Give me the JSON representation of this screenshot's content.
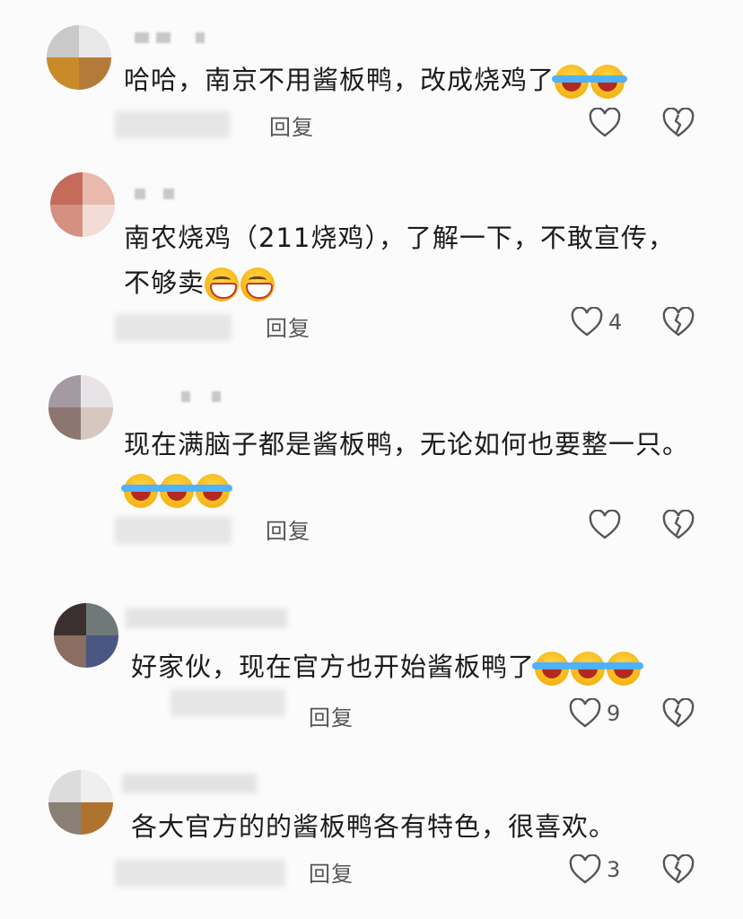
{
  "comments": [
    {
      "text": "哈哈，南京不用酱板鸭，改成烧鸡了",
      "text_line2": "",
      "emojis": [
        "cry",
        "cry"
      ],
      "reply_label": "回复",
      "likes": "",
      "avatar_colors": [
        "#c9c9c9",
        "#e9e9e9",
        "#c98a2a",
        "#b47a3a"
      ]
    },
    {
      "text": "南农烧鸡（211烧鸡），了解一下，不敢宣传，",
      "text_line2": "不够卖",
      "emojis": [
        "grin",
        "grin"
      ],
      "reply_label": "回复",
      "likes": "4",
      "avatar_colors": [
        "#c46b5c",
        "#e8b9ad",
        "#d49080",
        "#f3dcd5"
      ]
    },
    {
      "text": "现在满脑子都是酱板鸭，无论如何也要整一只。",
      "text_line2": "",
      "emojis": [
        "cry",
        "cry",
        "cry"
      ],
      "reply_label": "回复",
      "likes": "",
      "avatar_colors": [
        "#a39aa2",
        "#e7e3e6",
        "#8d7570",
        "#d7c7c1"
      ]
    },
    {
      "text": "好家伙，现在官方也开始酱板鸭了",
      "text_line2": "",
      "emojis": [
        "cry",
        "cry",
        "cry"
      ],
      "reply_label": "回复",
      "likes": "9",
      "avatar_colors": [
        "#3b302f",
        "#6f7a78",
        "#8b6d62",
        "#4b5683"
      ]
    },
    {
      "text": "各大官方的的酱板鸭各有特色，很喜欢。",
      "text_line2": "",
      "emojis": [],
      "reply_label": "回复",
      "likes": "3",
      "avatar_colors": [
        "#dcdcdc",
        "#efefef",
        "#8a7f74",
        "#b0732f"
      ]
    }
  ],
  "icons": {
    "like": "heart-outline-icon",
    "dislike": "broken-heart-icon"
  },
  "colors": {
    "text": "#1b1b1b",
    "meta": "#555555",
    "background": "#fbfbfb"
  }
}
